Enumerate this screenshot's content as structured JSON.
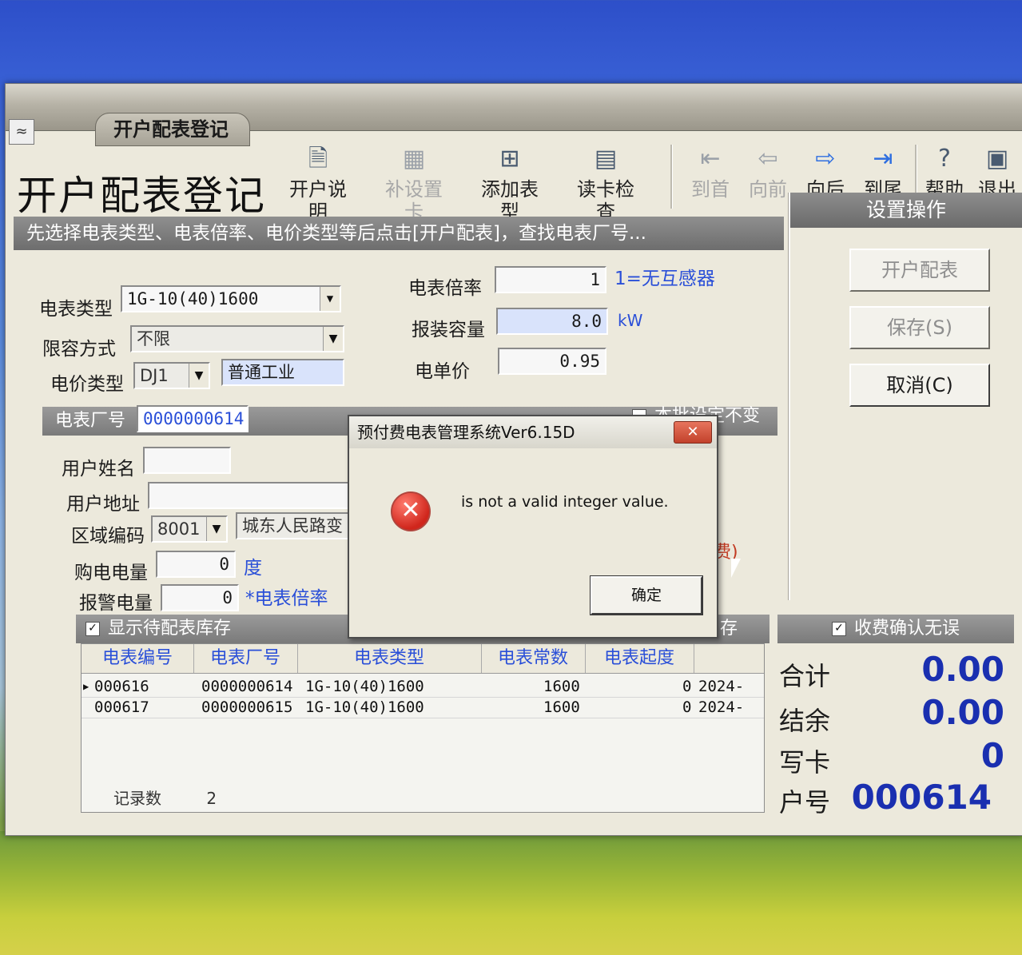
{
  "window": {
    "title": "开户配表登记",
    "heading": "开户配表登记"
  },
  "toolbar": {
    "items": [
      {
        "label": "开户说明",
        "state": "enabled"
      },
      {
        "label": "补设置卡",
        "state": "disabled"
      },
      {
        "label": "添加表型",
        "state": "enabled"
      },
      {
        "label": "读卡检查",
        "state": "enabled"
      },
      {
        "label": "到首",
        "state": "disabled"
      },
      {
        "label": "向前",
        "state": "disabled"
      },
      {
        "label": "向后",
        "state": "enabled"
      },
      {
        "label": "到尾",
        "state": "enabled"
      },
      {
        "label": "帮助",
        "state": "enabled"
      },
      {
        "label": "退出",
        "state": "enabled"
      }
    ]
  },
  "hint": "先选择电表类型、电表倍率、电价类型等后点击[开户配表]，查找电表厂号...",
  "form": {
    "meter_type_label": "电表类型",
    "meter_type_value": "1G-10(40)1600",
    "limit_mode_label": "限容方式",
    "limit_mode_value": "不限",
    "price_type_label": "电价类型",
    "price_type_value": "DJ1",
    "price_type_name": "普通工业",
    "ratio_label": "电表倍率",
    "ratio_value": "1",
    "ratio_note": "1=无互感器",
    "capacity_label": "报装容量",
    "capacity_value": "8.0",
    "capacity_unit": "kW",
    "unit_price_label": "电单价",
    "unit_price_value": "0.95",
    "keep_setting_label": "本批设定不变",
    "factory_no_label": "电表厂号",
    "factory_no_value": "0000000614",
    "user_name_label": "用户姓名",
    "user_name_value": "",
    "user_addr_label": "用户地址",
    "user_addr_value": "",
    "area_code_label": "区域编码",
    "area_code_value": "8001",
    "area_name": "城东人民路变",
    "purchase_label": "购电电量",
    "purchase_value": "0",
    "purchase_unit": "度",
    "alarm_label": "报警电量",
    "alarm_value": "0",
    "alarm_note": "*电表倍率",
    "partial_red": "费)",
    "partial_stock": "存"
  },
  "right_panel": {
    "title": "设置操作",
    "open_button": "开户配表",
    "save_button": "保存(S)",
    "cancel_button": "取消(C)"
  },
  "stock": {
    "show_label": "显示待配表库存",
    "columns": [
      "电表编号",
      "电表厂号",
      "电表类型",
      "电表常数",
      "电表起度"
    ],
    "rows": [
      {
        "id": "000616",
        "factory": "0000000614",
        "type": "1G-10(40)1600",
        "const": "1600",
        "start": "0",
        "date": "2024-"
      },
      {
        "id": "000617",
        "factory": "0000000615",
        "type": "1G-10(40)1600",
        "const": "1600",
        "start": "0",
        "date": "2024-"
      }
    ],
    "record_count_label": "记录数",
    "record_count": "2"
  },
  "totals": {
    "confirm_label": "收费确认无误",
    "sum_label": "合计",
    "sum_value": "0.00",
    "balance_label": "结余",
    "balance_value": "0.00",
    "write_label": "写卡",
    "write_value": "0",
    "account_label": "户号",
    "account_value": "000614"
  },
  "dialog": {
    "title": "预付费电表管理系统Ver6.15D",
    "close_glyph": "✕",
    "message": "is not a valid integer value.",
    "ok_button": "确定"
  }
}
